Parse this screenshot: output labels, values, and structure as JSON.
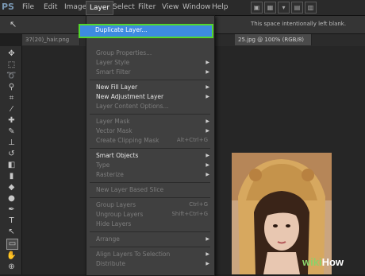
{
  "app": {
    "logo": "PS",
    "menubar": [
      "File",
      "Edit",
      "Image",
      "Layer",
      "Select",
      "Filter",
      "View",
      "Window",
      "Help"
    ],
    "active_menu": "Layer"
  },
  "options_bar": {
    "message": "This space intentionally left blank."
  },
  "tabs": [
    {
      "label": "37(20)_hair.png @ 8"
    },
    {
      "label": "25.jpg @ 100% (RGB/8)"
    }
  ],
  "layer_menu": {
    "highlighted": "Duplicate Layer...",
    "items": [
      {
        "label": "Group Properties...",
        "enabled": false
      },
      {
        "label": "Layer Style",
        "enabled": false,
        "submenu": true
      },
      {
        "label": "Smart Filter",
        "enabled": false,
        "submenu": true
      },
      {
        "label": "New Fill Layer",
        "enabled": true,
        "submenu": true
      },
      {
        "label": "New Adjustment Layer",
        "enabled": true,
        "submenu": true
      },
      {
        "label": "Layer Content Options...",
        "enabled": false
      },
      {
        "label": "Layer Mask",
        "enabled": false,
        "submenu": true
      },
      {
        "label": "Vector Mask",
        "enabled": false,
        "submenu": true
      },
      {
        "label": "Create Clipping Mask",
        "enabled": false,
        "shortcut": "Alt+Ctrl+G"
      },
      {
        "label": "Smart Objects",
        "enabled": true,
        "submenu": true
      },
      {
        "label": "Type",
        "enabled": false,
        "submenu": true
      },
      {
        "label": "Rasterize",
        "enabled": false,
        "submenu": true
      },
      {
        "label": "New Layer Based Slice",
        "enabled": false
      },
      {
        "label": "Group Layers",
        "enabled": false,
        "shortcut": "Ctrl+G"
      },
      {
        "label": "Ungroup Layers",
        "enabled": false,
        "shortcut": "Shift+Ctrl+G"
      },
      {
        "label": "Hide Layers",
        "enabled": false
      },
      {
        "label": "Arrange",
        "enabled": false,
        "submenu": true
      },
      {
        "label": "Align Layers To Selection",
        "enabled": false,
        "submenu": true
      },
      {
        "label": "Distribute",
        "enabled": false,
        "submenu": true
      }
    ]
  },
  "watermark": {
    "prefix": "wiki",
    "suffix": "How"
  },
  "colors": {
    "highlight": "#3d8be0",
    "highlight_border": "#53d72c"
  }
}
